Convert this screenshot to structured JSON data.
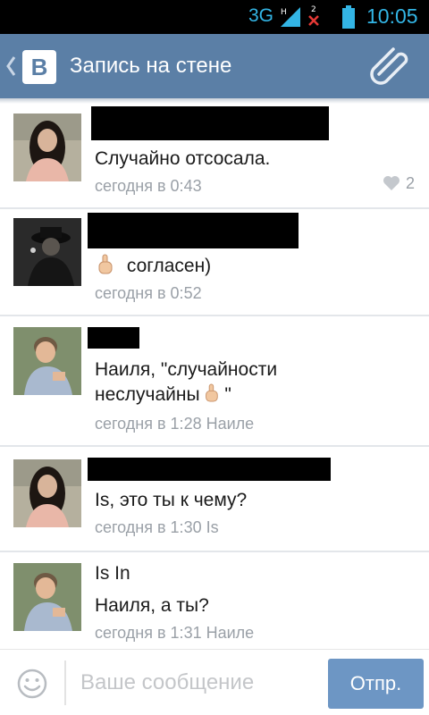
{
  "status_bar": {
    "network": "3G",
    "sim_label": "2",
    "time": "10:05"
  },
  "header": {
    "title": "Запись на стене",
    "logo_letter": "В"
  },
  "comments": [
    {
      "text": "Случайно отсосала.",
      "meta": "сегодня в 0:43",
      "likes": "2"
    },
    {
      "text": "согласен)",
      "meta": "сегодня в 0:52"
    },
    {
      "text_line1": "Наиля, \"случайности",
      "text_line2": "неслучайны",
      "text_end": " \"",
      "meta": "сегодня в 1:28 Наиле"
    },
    {
      "text": "Is, это ты к чему?",
      "meta": "сегодня в 1:30 Is"
    },
    {
      "name": "Is In",
      "text": "Наиля, а ты?",
      "meta": "сегодня в 1:31 Наиле"
    }
  ],
  "composer": {
    "placeholder": "Ваше сообщение",
    "send_label": "Отпр."
  },
  "colors": {
    "header": "#5b7fa6",
    "accent": "#33b5e5",
    "send": "#6d96c4",
    "meta": "#9aa0a7"
  }
}
